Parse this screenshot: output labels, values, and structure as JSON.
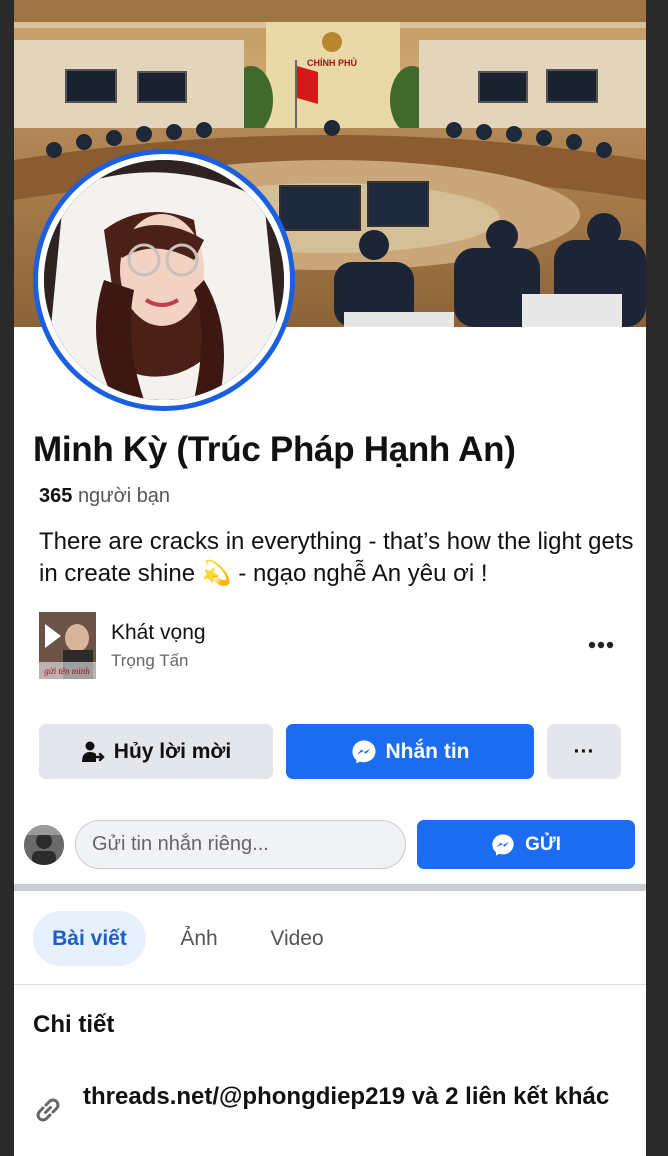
{
  "profile": {
    "name": "Minh Kỳ (Trúc Pháp Hạnh An)",
    "friends_count": "365",
    "friends_label": "người bạn",
    "bio": "There are cracks in everything - that’s how the light gets in create shine 💫 - ngạo nghễ An yêu ơi !",
    "cover_sign_text": "CHÍNH PHỦ"
  },
  "music": {
    "title": "Khát vọng",
    "artist": "Trọng Tấn",
    "thumb_caption": "gửi tên mình",
    "more_icon": "ellipsis-icon"
  },
  "actions": {
    "cancel_request_label": "Hủy lời mời",
    "cancel_request_icon": "person-arrow-icon",
    "message_label": "Nhắn tin",
    "message_icon": "messenger-icon",
    "more_label": "···"
  },
  "private_message": {
    "placeholder": "Gửi tin nhắn riêng...",
    "send_label": "GỬI",
    "send_icon": "messenger-icon"
  },
  "tabs": [
    {
      "label": "Bài viết",
      "active": true
    },
    {
      "label": "Ảnh",
      "active": false
    },
    {
      "label": "Video",
      "active": false
    }
  ],
  "details": {
    "title": "Chi tiết",
    "link_text": "threads.net/@phongdiep219 và 2 liên kết khác",
    "link_icon": "link-icon"
  },
  "colors": {
    "accent": "#1b6cf0",
    "avatar_ring": "#1b5fe0",
    "active_tab_bg": "#e7f0fd",
    "button_gray": "#e4e6eb"
  }
}
